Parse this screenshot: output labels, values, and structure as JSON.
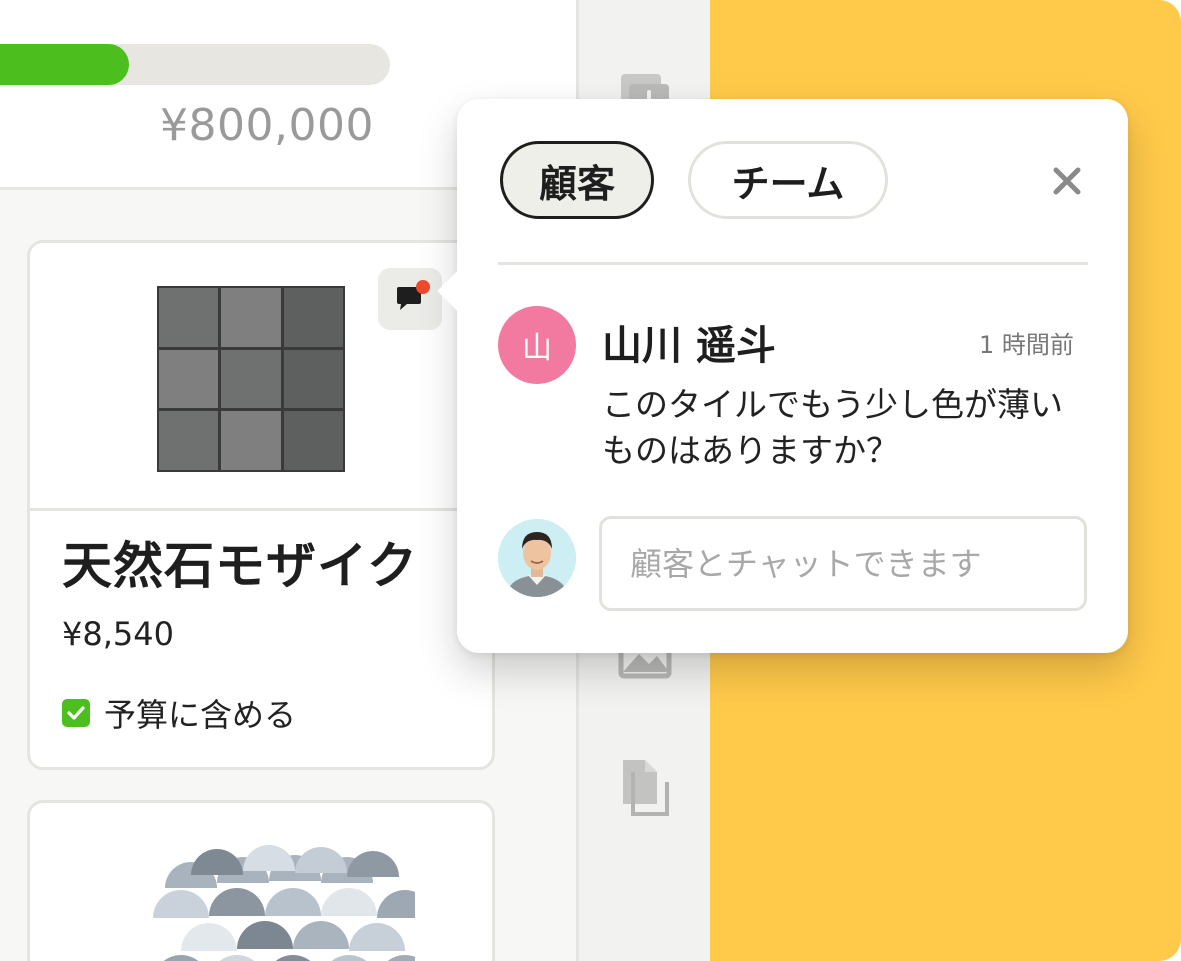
{
  "budget": {
    "amount": "¥800,000",
    "progress": 0.33
  },
  "products": [
    {
      "name": "天然石モザイク",
      "price": "¥8,540",
      "include_label": "予算に含める",
      "include_checked": true,
      "has_unread_chat": true
    }
  ],
  "toolbar": {
    "icons": [
      "download-icon",
      "image-icon",
      "documents-icon"
    ]
  },
  "chat": {
    "tabs": [
      {
        "label": "顧客",
        "active": true
      },
      {
        "label": "チーム",
        "active": false
      }
    ],
    "message": {
      "avatar_initial": "山",
      "author": "山川 遥斗",
      "time": "1 時間前",
      "text": "このタイルでもう少し色が薄いものはありますか？"
    },
    "input_placeholder": "顧客とチャットできます"
  },
  "colors": {
    "progress_fill": "#4cbf1e",
    "accent_yellow": "#ffc94a",
    "badge_dot": "#ef4a2e",
    "author_avatar": "#f27aa0"
  }
}
